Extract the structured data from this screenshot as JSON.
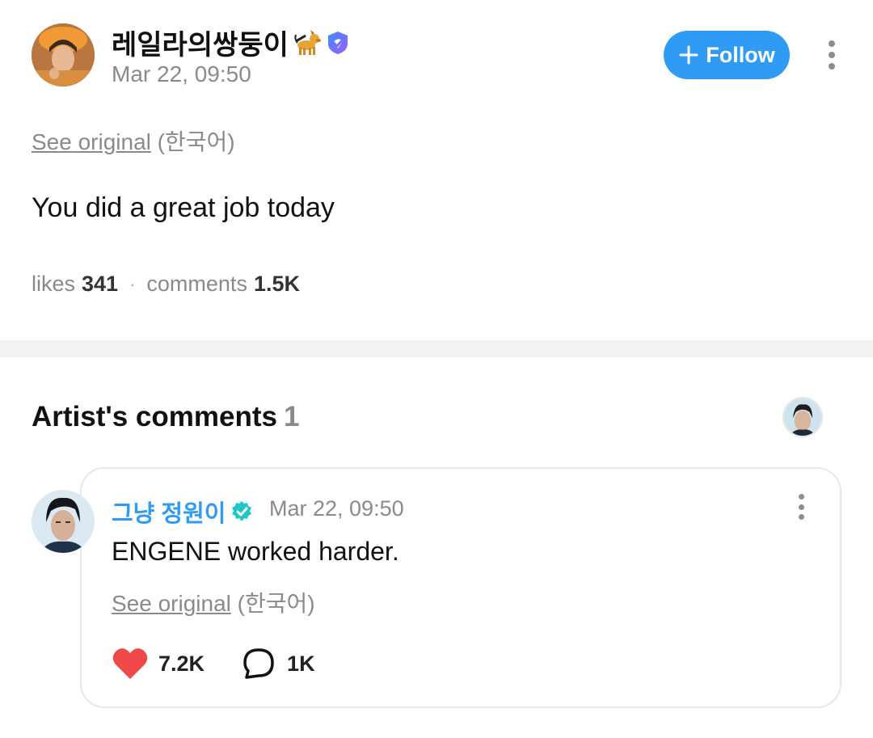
{
  "post": {
    "author_name": "레일라의쌍둥이",
    "timestamp": "Mar 22, 09:50",
    "follow_label": "Follow",
    "see_original_label": "See original",
    "original_language": "(한국어)",
    "text": "You did a great job today",
    "stats": {
      "likes_label": "likes",
      "likes_value": "341",
      "separator": "·",
      "comments_label": "comments",
      "comments_value": "1.5K"
    }
  },
  "artist_comments": {
    "title": "Artist's comments",
    "count": "1",
    "comment": {
      "author_name": "그냥 정원이",
      "timestamp": "Mar 22, 09:50",
      "text": "ENGENE worked harder.",
      "see_original_label": "See original",
      "original_language": "(한국어)",
      "likes": "7.2K",
      "replies": "1K"
    }
  },
  "icons": {
    "author_badge": "dog-emoji-icon",
    "author_verified": "verified-badge-purple-icon",
    "follow_plus": "plus-icon",
    "more": "more-vertical-icon",
    "comment_verified": "verified-badge-teal-icon",
    "like": "heart-icon",
    "reply": "speech-bubble-icon"
  },
  "colors": {
    "accent_blue": "#2f9bf5",
    "verified_purple": "#7b61ff",
    "verified_teal": "#1cc6c9",
    "heart_red": "#f04848",
    "muted_text": "#8a8a8a"
  }
}
